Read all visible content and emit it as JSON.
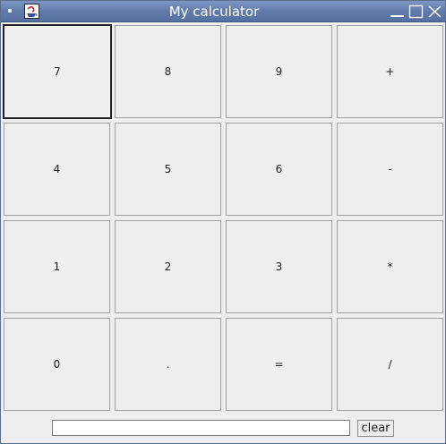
{
  "window": {
    "title": "My calculator"
  },
  "keypad": {
    "rows": [
      [
        "7",
        "8",
        "9",
        "+"
      ],
      [
        "4",
        "5",
        "6",
        "-"
      ],
      [
        "1",
        "2",
        "3",
        "*"
      ],
      [
        "0",
        ".",
        "=",
        "/"
      ]
    ]
  },
  "display": {
    "value": ""
  },
  "controls": {
    "clear_label": "clear"
  },
  "colors": {
    "titlebar": "#6a82b0",
    "background": "#eeeeee",
    "button": "#efefef",
    "button_border": "#a3a3a3"
  },
  "icons": {
    "app": "java-cup-icon",
    "minimize": "minimize-icon",
    "maximize": "maximize-icon",
    "close": "close-icon"
  }
}
